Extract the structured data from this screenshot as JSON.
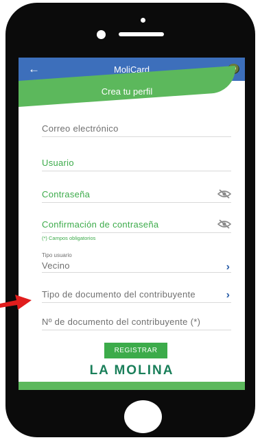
{
  "app": {
    "title": "MoliCard",
    "banner": "Crea tu perfil"
  },
  "fields": {
    "email": "Correo electrónico",
    "user": "Usuario",
    "password": "Contraseña",
    "confirm": "Confirmación de contraseña",
    "required_note": "(*) Campos obligatorios",
    "user_type_label": "Tipo usuario",
    "user_type_value": "Vecino",
    "doc_type": "Tipo de documento del contribuyente",
    "doc_number": "Nº de documento del contribuyente (*)"
  },
  "buttons": {
    "register": "REGISTRAR"
  },
  "brand": {
    "text": "LA MOLINA"
  },
  "colors": {
    "appbar": "#3d6fbb",
    "green": "#5cb85c",
    "accent_green": "#3cab4a",
    "chevron": "#2a5ea8",
    "arrow": "#e11d1d"
  },
  "icons": [
    "back-arrow-icon",
    "crest-icon",
    "eye-off-icon",
    "chevron-right-icon",
    "red-arrow-icon"
  ]
}
